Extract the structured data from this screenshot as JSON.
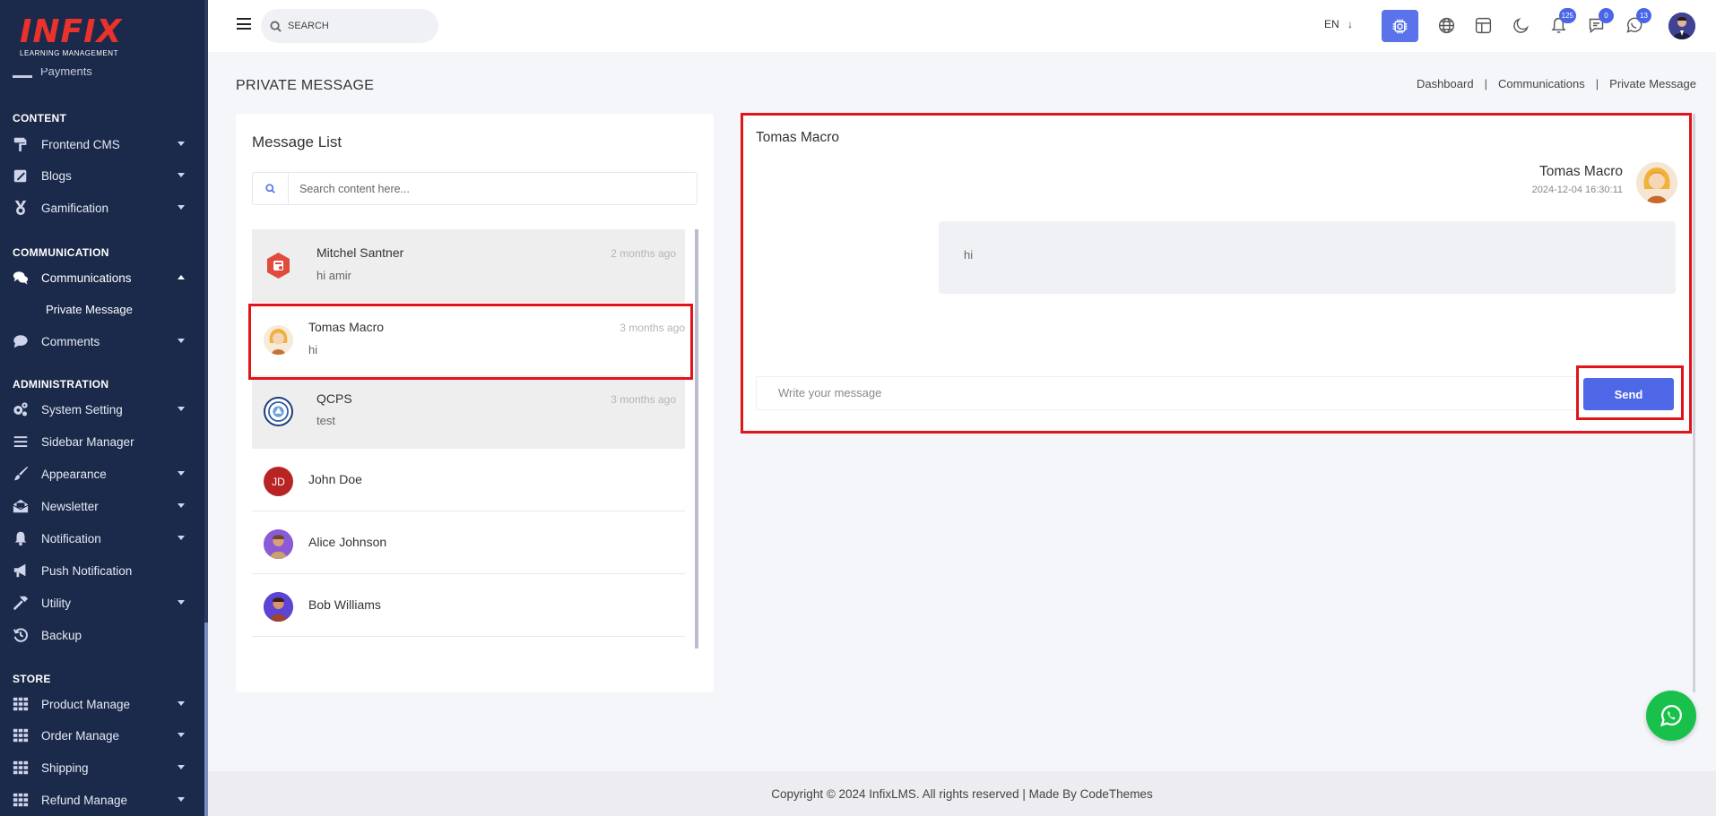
{
  "brand": {
    "logo_text": "INFIX",
    "logo_sub": "LEARNING MANAGEMENT",
    "accent": "#e8322b",
    "primary": "#5a72ea",
    "highlight": "#e1141a"
  },
  "sidebar": {
    "partial_item": "Payments",
    "sections": [
      {
        "title": "CONTENT",
        "items": [
          {
            "label": "Frontend CMS",
            "icon": "paint-roller-icon",
            "caret": "down"
          },
          {
            "label": "Blogs",
            "icon": "edit-icon",
            "caret": "down"
          },
          {
            "label": "Gamification",
            "icon": "medal-icon",
            "caret": "down"
          }
        ]
      },
      {
        "title": "COMMUNICATION",
        "items": [
          {
            "label": "Communications",
            "icon": "comments-icon",
            "caret": "up",
            "sub": "Private Message"
          },
          {
            "label": "Comments",
            "icon": "comment-icon",
            "caret": "down"
          }
        ]
      },
      {
        "title": "ADMINISTRATION",
        "items": [
          {
            "label": "System Setting",
            "icon": "gears-icon",
            "caret": "down"
          },
          {
            "label": "Sidebar Manager",
            "icon": "bars-icon",
            "caret": ""
          },
          {
            "label": "Appearance",
            "icon": "brush-icon",
            "caret": "down"
          },
          {
            "label": "Newsletter",
            "icon": "envelope-open-icon",
            "caret": "down"
          },
          {
            "label": "Notification",
            "icon": "bell-icon",
            "caret": "down"
          },
          {
            "label": "Push Notification",
            "icon": "bullhorn-icon",
            "caret": ""
          },
          {
            "label": "Utility",
            "icon": "hammer-icon",
            "caret": "down"
          },
          {
            "label": "Backup",
            "icon": "history-icon",
            "caret": ""
          }
        ]
      },
      {
        "title": "STORE",
        "items": [
          {
            "label": "Product Manage",
            "icon": "grid-icon",
            "caret": "down"
          },
          {
            "label": "Order Manage",
            "icon": "grid-icon",
            "caret": "down"
          },
          {
            "label": "Shipping",
            "icon": "grid-icon",
            "caret": "down"
          },
          {
            "label": "Refund Manage",
            "icon": "grid-icon",
            "caret": "down"
          }
        ]
      }
    ]
  },
  "header": {
    "search_placeholder": "SEARCH",
    "lang": "EN",
    "badges": {
      "notifications": "125",
      "messages": "0",
      "whatsapp": "13"
    }
  },
  "page": {
    "title": "PRIVATE MESSAGE",
    "breadcrumb": [
      "Dashboard",
      "Communications",
      "Private Message"
    ]
  },
  "message_list": {
    "title": "Message List",
    "search_placeholder": "Search content here...",
    "items": [
      {
        "name": "Mitchel Santner",
        "time": "2 months ago",
        "preview": "hi amir"
      },
      {
        "name": "Tomas Macro",
        "time": "3 months ago",
        "preview": "hi"
      },
      {
        "name": "QCPS",
        "time": "3 months ago",
        "preview": "test"
      },
      {
        "name": "John Doe",
        "initials": "JD"
      },
      {
        "name": "Alice Johnson"
      },
      {
        "name": "Bob Williams"
      }
    ]
  },
  "chat": {
    "title": "Tomas Macro",
    "sender_name": "Tomas Macro",
    "sender_time": "2024-12-04 16:30:11",
    "message": "hi",
    "input_placeholder": "Write your message",
    "send_label": "Send"
  },
  "footer": {
    "text": "Copyright © 2024 InfixLMS. All rights reserved | Made By CodeThemes"
  }
}
